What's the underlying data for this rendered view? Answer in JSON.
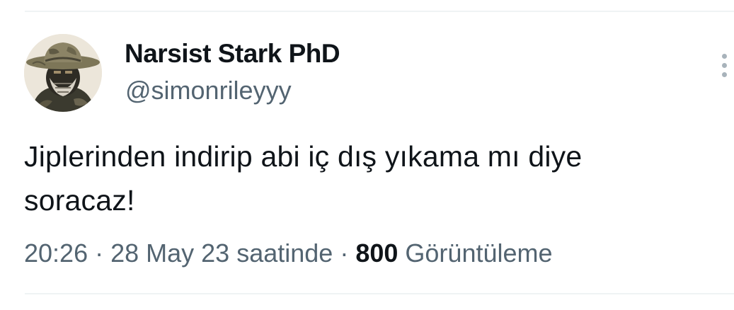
{
  "author": {
    "display_name": "Narsist Stark PhD",
    "handle": "@simonrileyyy"
  },
  "tweet": {
    "text_line1": "Jiplerinden indirip abi iç dış yıkama mı diye",
    "text_line2": "soracaz!"
  },
  "meta": {
    "time": "20:26",
    "separator": " · ",
    "date": "28 May 23 saatinde",
    "views_count": "800",
    "views_label": "Görüntüleme"
  },
  "icons": {
    "more": "more-vertical-icon"
  },
  "colors": {
    "text_primary": "#0f1419",
    "text_secondary": "#536471",
    "divider": "#eff3f4"
  }
}
